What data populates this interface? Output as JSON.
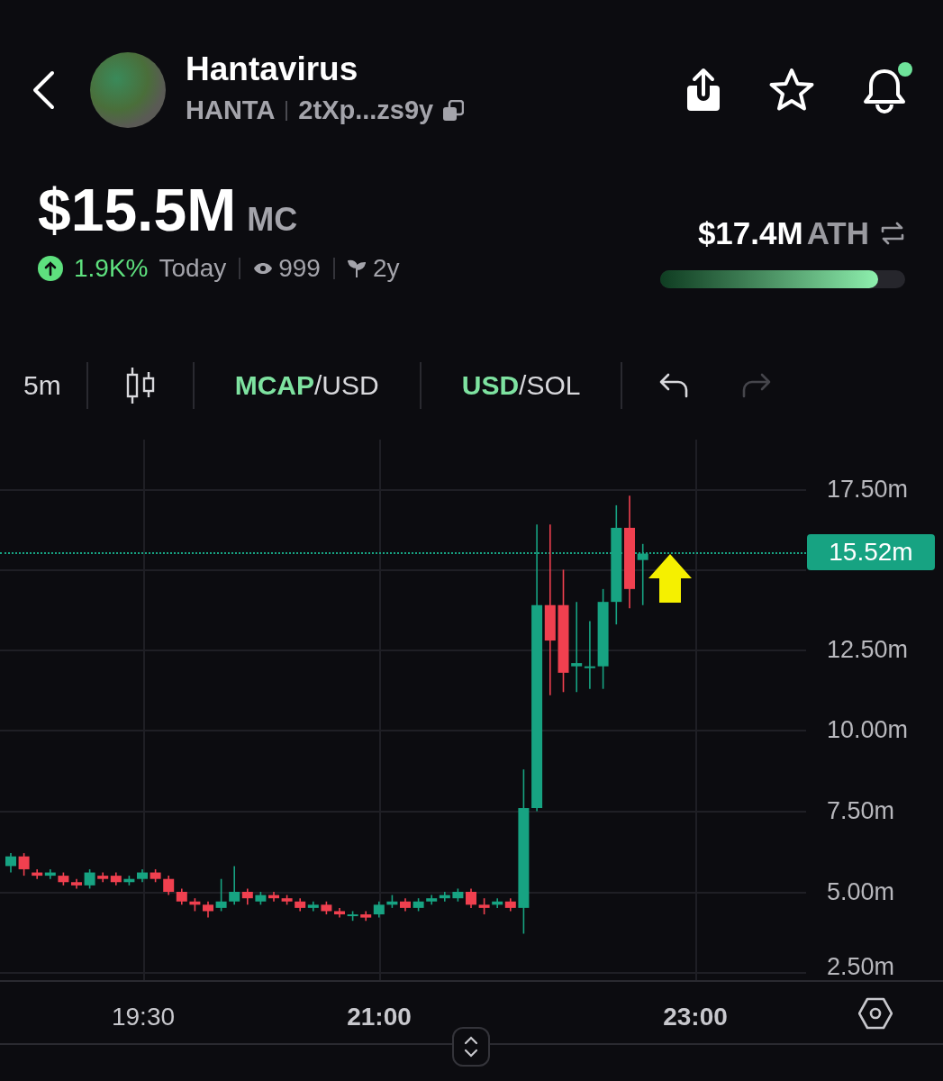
{
  "token": {
    "name": "Hantavirus",
    "symbol": "HANTA",
    "address": "2tXp...zs9y"
  },
  "header": {
    "notifications_dot": true
  },
  "market_cap": {
    "value": "$15.5M",
    "unit": "MC",
    "change": "1.9K%",
    "period": "Today",
    "views": "999",
    "age": "2y"
  },
  "ath": {
    "value": "$17.4M",
    "label": "ATH",
    "level": 0.89
  },
  "toolbar": {
    "interval": "5m",
    "pairs": [
      [
        {
          "label": "MCAP",
          "selected": true
        },
        {
          "label": "/USD",
          "selected": false
        }
      ],
      [
        {
          "label": "USD",
          "selected": true
        },
        {
          "label": "/SOL",
          "selected": false
        }
      ]
    ],
    "undo_disabled": false,
    "redo_disabled": true
  },
  "chart": {
    "price_tag": "15.52m",
    "y_labels": [
      "17.50m",
      "12.50m",
      "10.00m",
      "7.50m",
      "5.00m",
      "2.50m"
    ],
    "x_labels": [
      {
        "label": "19:30",
        "bold": false
      },
      {
        "label": "21:00",
        "bold": true
      },
      {
        "label": "23:00",
        "bold": true
      }
    ]
  }
}
